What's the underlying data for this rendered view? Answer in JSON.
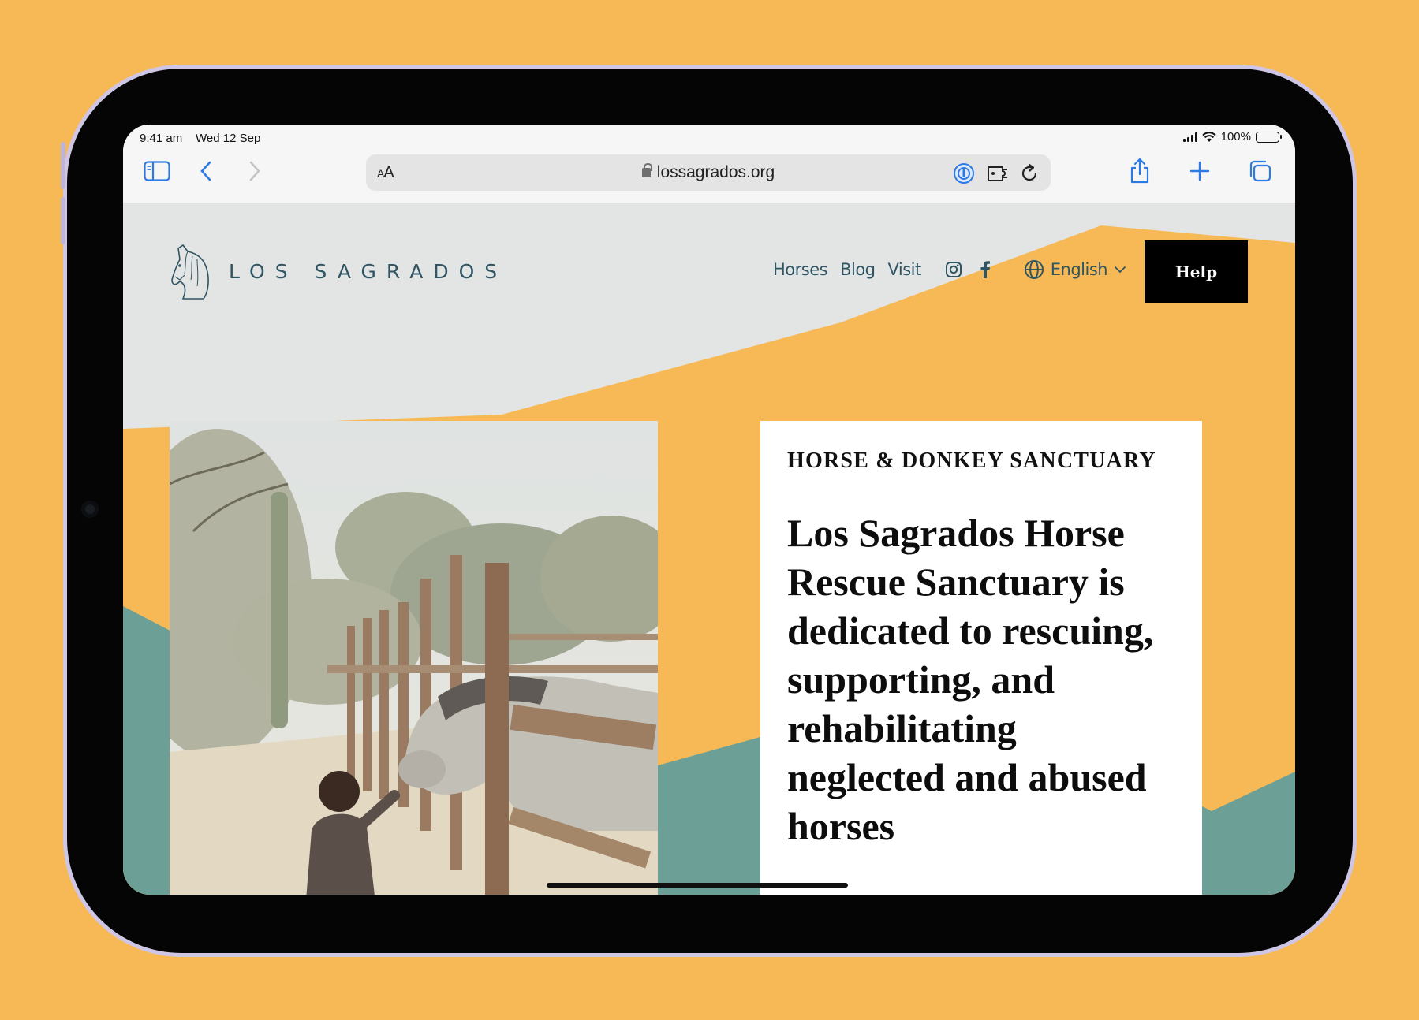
{
  "status_bar": {
    "time": "9:41 am",
    "date": "Wed 12 Sep",
    "battery": "100%"
  },
  "browser": {
    "text_size_small": "A",
    "text_size_large": "A",
    "url": "lossagrados.org",
    "icons": [
      "sidebar-icon",
      "back-icon",
      "forward-icon",
      "password-icon",
      "extension-icon",
      "reload-icon",
      "share-icon",
      "new-tab-icon",
      "tabs-icon"
    ]
  },
  "site": {
    "logo_text": "LOS SAGRADOS",
    "nav": {
      "horses": "Horses",
      "blog": "Blog",
      "visit": "Visit"
    },
    "language": "English",
    "help": "Help"
  },
  "hero": {
    "eyebrow": "HORSE & DONKEY SANCTUARY",
    "heading": "Los Sagrados Horse Rescue Sanctuary is dedicated to rescuing, supporting, and rehabilitating neglected and abused horses"
  },
  "colors": {
    "background": "#f7b955",
    "page_gray": "#e3e4e4",
    "orange": "#f7b955",
    "teal": "#6c9f96",
    "brand_text": "#2f5563"
  }
}
